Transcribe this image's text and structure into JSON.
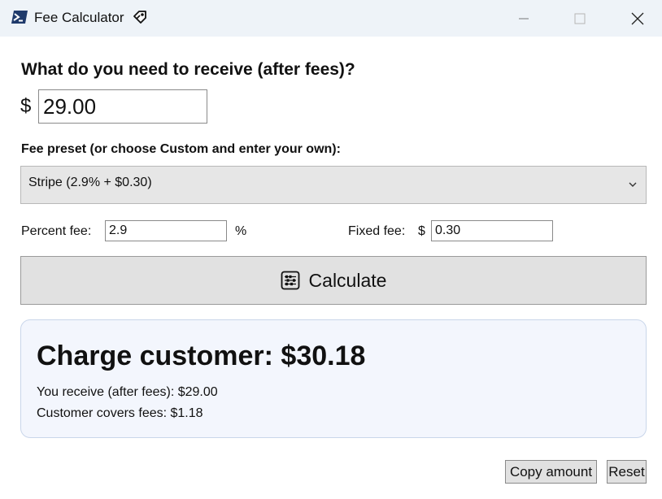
{
  "window": {
    "title": "Fee Calculator",
    "title_icon": "powershell-icon",
    "title_emoji_icon": "diamond-tag-icon",
    "controls": [
      "minimize-icon",
      "maximize-icon",
      "close-icon"
    ]
  },
  "form": {
    "heading": "What do you need to receive (after fees)?",
    "currency_symbol": "$",
    "amount_value": "29.00",
    "preset_label": "Fee preset (or choose Custom and enter your own):",
    "preset_selected": "Stripe (2.9% + $0.30)",
    "percent_label": "Percent fee:",
    "percent_value": "2.9",
    "percent_unit": "%",
    "fixed_label": "Fixed fee:",
    "fixed_currency": "$",
    "fixed_value": "0.30",
    "calculate_label": "Calculate",
    "calculate_icon": "abacus-icon"
  },
  "result": {
    "title": "Charge customer: $30.18",
    "receive_line": "You receive (after fees): $29.00",
    "fees_line": "Customer covers fees: $1.18"
  },
  "actions": {
    "copy_label": "Copy amount",
    "reset_label": "Reset"
  },
  "colors": {
    "titlebar": "#eef3f8",
    "result_bg": "#f3f6fd",
    "result_border": "#c9d6ea",
    "button_bg": "#e1e1e1"
  }
}
